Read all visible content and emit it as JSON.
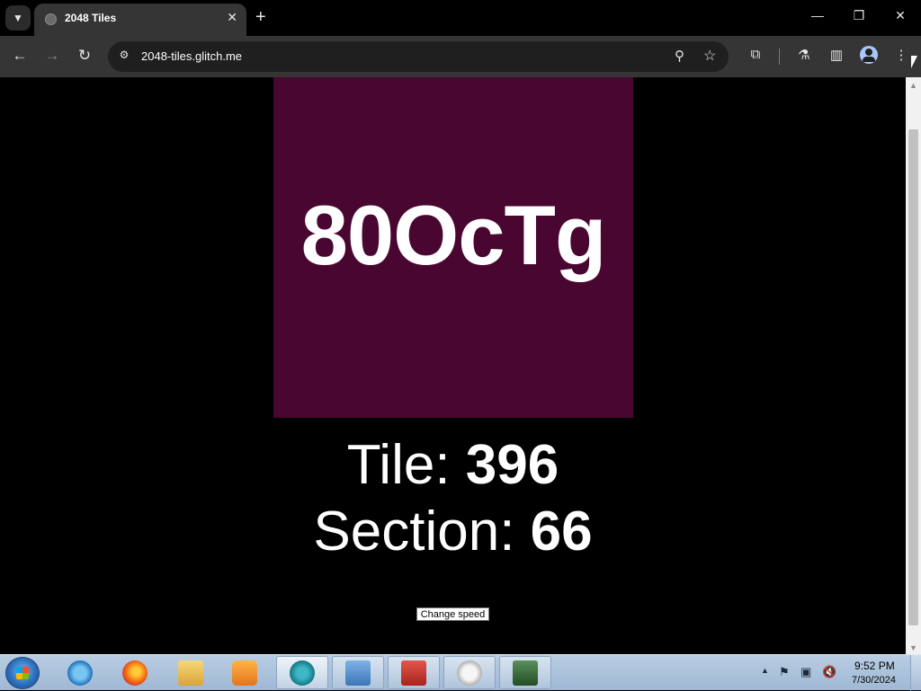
{
  "browser": {
    "tab_title": "2048 Tiles",
    "tab_close": "✕",
    "new_tab": "+",
    "url": "2048-tiles.glitch.me",
    "window_controls": {
      "minimize": "—",
      "restore": "❐",
      "close": "✕"
    },
    "icons": {
      "tab_search": "chevron-down-icon",
      "back": "back-arrow-icon",
      "forward": "forward-arrow-icon",
      "reload": "reload-icon",
      "site_info": "tune-icon",
      "zoom": "zoom-icon",
      "bookmark": "star-icon",
      "extensions": "puzzle-icon",
      "labs": "flask-icon",
      "side_panel": "side-panel-icon",
      "profile": "profile-icon",
      "menu": "kebab-menu-icon"
    }
  },
  "page": {
    "tile_text": "80OcTg",
    "tile_color": "#480631",
    "tile_label": "Tile: ",
    "tile_value": "396",
    "section_label": "Section: ",
    "section_value": "66",
    "change_speed_label": "Change speed"
  },
  "taskbar": {
    "apps": [
      {
        "name": "internet-explorer-icon",
        "open": false
      },
      {
        "name": "firefox-icon",
        "open": false
      },
      {
        "name": "file-explorer-icon",
        "open": false
      },
      {
        "name": "media-player-icon",
        "open": false
      },
      {
        "name": "chrome-app-icon",
        "open": true,
        "active": true
      },
      {
        "name": "control-panel-icon",
        "open": true
      },
      {
        "name": "toolbox-icon",
        "open": true
      },
      {
        "name": "speedometer-icon",
        "open": true
      },
      {
        "name": "monitor-icon",
        "open": true
      }
    ],
    "clock_time": "9:52 PM",
    "clock_date": "7/30/2024"
  }
}
